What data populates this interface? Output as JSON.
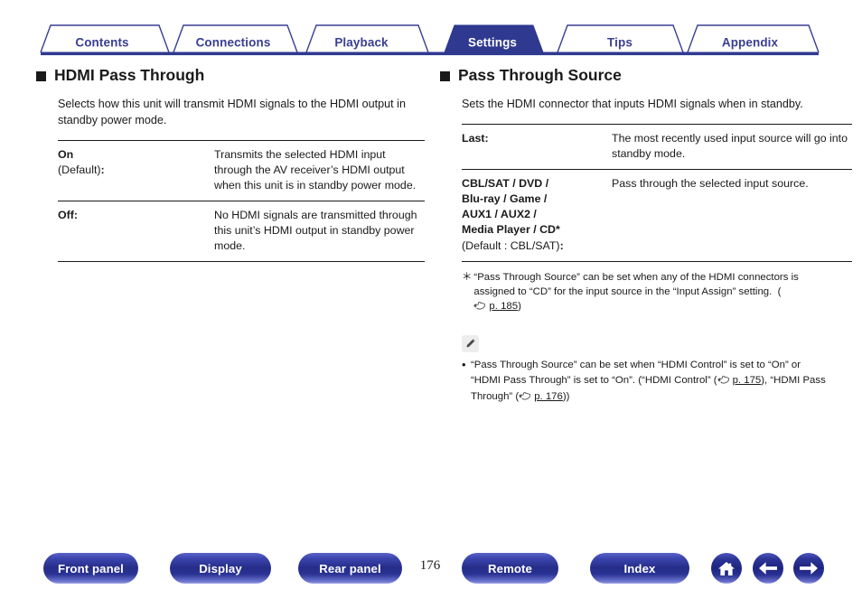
{
  "tabs": [
    {
      "label": "Contents",
      "active": false
    },
    {
      "label": "Connections",
      "active": false
    },
    {
      "label": "Playback",
      "active": false
    },
    {
      "label": "Settings",
      "active": true
    },
    {
      "label": "Tips",
      "active": false
    },
    {
      "label": "Appendix",
      "active": false
    }
  ],
  "colors": {
    "brand_blue": "#3a3f92",
    "tab_active_fill": "#2f3990",
    "tab_text": "#3a3f92",
    "text": "#1a1a1a",
    "note_icon_bg": "#ededed"
  },
  "left": {
    "title": "HDMI Pass Through",
    "intro": "Selects how this unit will transmit HDMI signals to the HDMI output in standby power mode.",
    "rows": [
      {
        "name": "On",
        "sub": "(Default)",
        "colon": ":",
        "desc": "Transmits the selected HDMI input through the AV receiver’s HDMI output when this unit is in standby power mode."
      },
      {
        "name": "Off",
        "sub": "",
        "colon": ":",
        "desc": "No HDMI signals are transmitted through this unit’s HDMI output in standby power mode."
      }
    ]
  },
  "right": {
    "title": "Pass Through Source",
    "intro": "Sets the HDMI connector that inputs HDMI signals when in standby.",
    "rows": [
      {
        "name": "Last",
        "sub": "",
        "colon": ":",
        "desc": "The most recently used input source will go into standby mode."
      },
      {
        "name": "CBL/SAT / DVD /\nBlu-ray / Game /\nAUX1 / AUX2 /\nMedia Player / CD*",
        "sub": "(Default : CBL/SAT)",
        "colon": ":",
        "desc": "Pass through the selected input source."
      }
    ],
    "footnote": {
      "mark": "＊",
      "text_before": "“Pass Through Source” can be set when any of the HDMI connectors is assigned to “CD” for the input source in the “Input Assign” setting.  (",
      "link": "p. 185",
      "text_after": ")"
    },
    "note": {
      "icon": "pencil-icon",
      "bullet": "•",
      "part1": "“Pass Through Source” can be set when “HDMI Control” is set to “On” or “HDMI Pass Through” is set to “On”. (“HDMI Control” (",
      "link1": "p. 175",
      "part2": "), “HDMI Pass Through” (",
      "link2": "p. 176",
      "part3": "))"
    }
  },
  "footer": {
    "page_number": "176",
    "buttons": [
      {
        "label": "Front panel",
        "name": "front-panel-button"
      },
      {
        "label": "Display",
        "name": "display-button"
      },
      {
        "label": "Rear panel",
        "name": "rear-panel-button"
      },
      {
        "label": "Remote",
        "name": "remote-button"
      },
      {
        "label": "Index",
        "name": "index-button"
      }
    ],
    "icons": [
      {
        "name": "home-icon"
      },
      {
        "name": "arrow-left-icon"
      },
      {
        "name": "arrow-right-icon"
      }
    ]
  }
}
